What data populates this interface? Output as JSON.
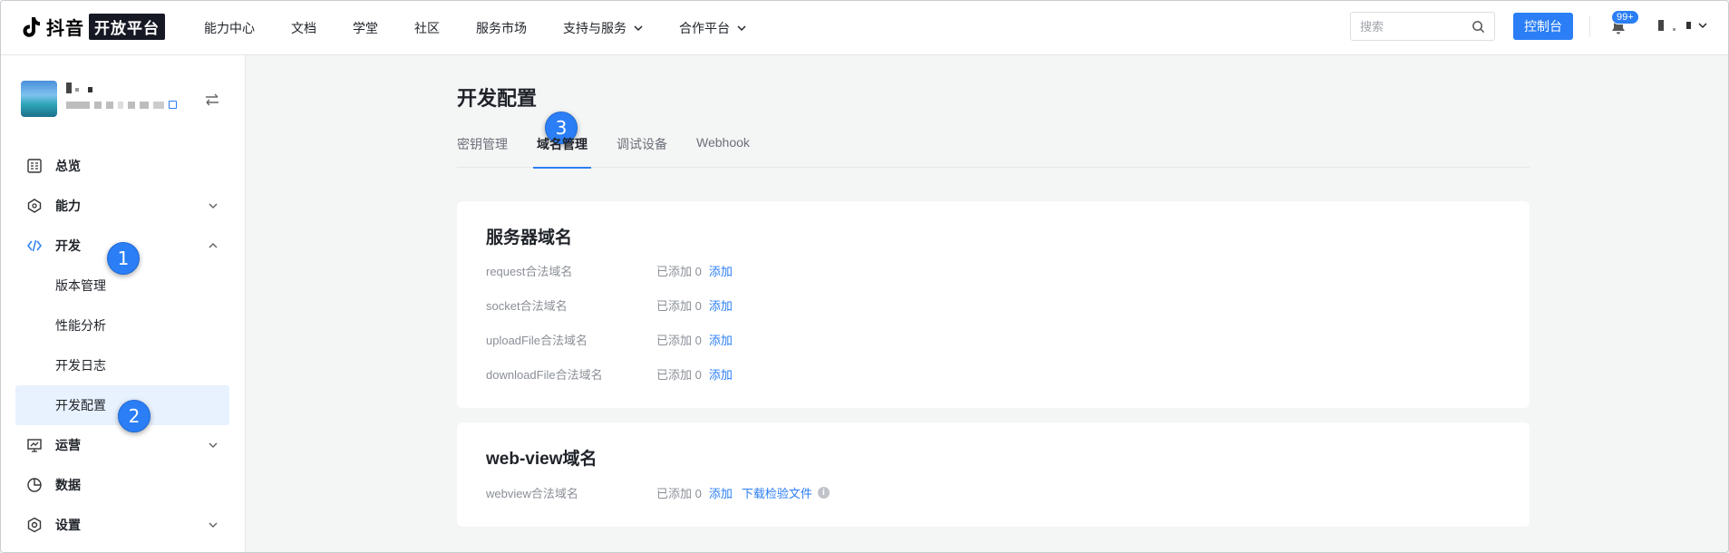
{
  "header": {
    "brand": "抖音",
    "brand_box": "开放平台",
    "nav": [
      {
        "label": "能力中心"
      },
      {
        "label": "文档"
      },
      {
        "label": "学堂"
      },
      {
        "label": "社区"
      },
      {
        "label": "服务市场"
      },
      {
        "label": "支持与服务"
      },
      {
        "label": "合作平台"
      }
    ],
    "search_placeholder": "搜索",
    "console_label": "控制台",
    "notification_badge": "99+"
  },
  "sidebar": {
    "menu": {
      "overview": "总览",
      "ability": "能力",
      "develop": "开发",
      "version": "版本管理",
      "performance": "性能分析",
      "devlog": "开发日志",
      "devconfig": "开发配置",
      "operation": "运营",
      "data": "数据",
      "settings": "设置"
    }
  },
  "steps": {
    "s1": "1",
    "s2": "2",
    "s3": "3"
  },
  "main": {
    "title": "开发配置",
    "tabs": [
      "密钥管理",
      "域名管理",
      "调试设备",
      "Webhook"
    ],
    "server_card": {
      "title": "服务器域名",
      "rows": [
        {
          "label": "request合法域名",
          "count": "已添加 0",
          "action": "添加"
        },
        {
          "label": "socket合法域名",
          "count": "已添加 0",
          "action": "添加"
        },
        {
          "label": "uploadFile合法域名",
          "count": "已添加 0",
          "action": "添加"
        },
        {
          "label": "downloadFile合法域名",
          "count": "已添加 0",
          "action": "添加"
        }
      ]
    },
    "webview_card": {
      "title": "web-view域名",
      "row": {
        "label": "webview合法域名",
        "count": "已添加 0",
        "action": "添加",
        "download": "下载检验文件"
      }
    }
  },
  "colors": {
    "accent": "#2b7ef5",
    "active_bg": "#e8f1fe"
  }
}
